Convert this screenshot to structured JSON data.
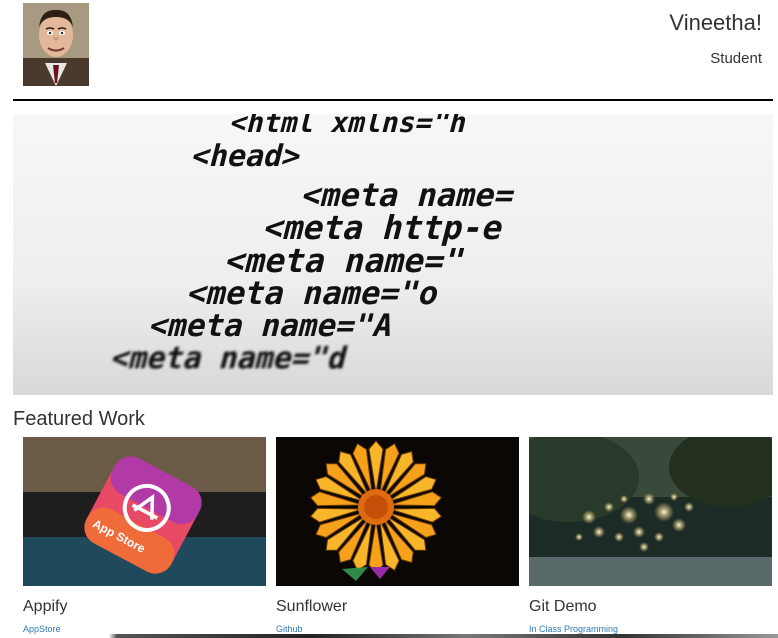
{
  "header": {
    "name": "Vineetha!",
    "role": "Student"
  },
  "featured": {
    "title": "Featured Work",
    "items": [
      {
        "title": "Appify",
        "subtitle": "AppStore",
        "image": "app-store-icon"
      },
      {
        "title": "Sunflower",
        "subtitle": "Github",
        "image": "sunflower-image"
      },
      {
        "title": "Git Demo",
        "subtitle": "In Class Programming",
        "image": "bokeh-lights-image"
      }
    ]
  },
  "hero": {
    "code_lines": [
      "<html xmlns=\"h",
      "<head>",
      "<meta name=",
      "<meta http-e",
      "<meta name=\"",
      "<meta name=\"o",
      "<meta name=\"A",
      "<meta name=\"d"
    ],
    "image": "html-code-image"
  },
  "colors": {
    "accent_link": "#337ab7",
    "rule": "#000000",
    "text": "#333333"
  }
}
